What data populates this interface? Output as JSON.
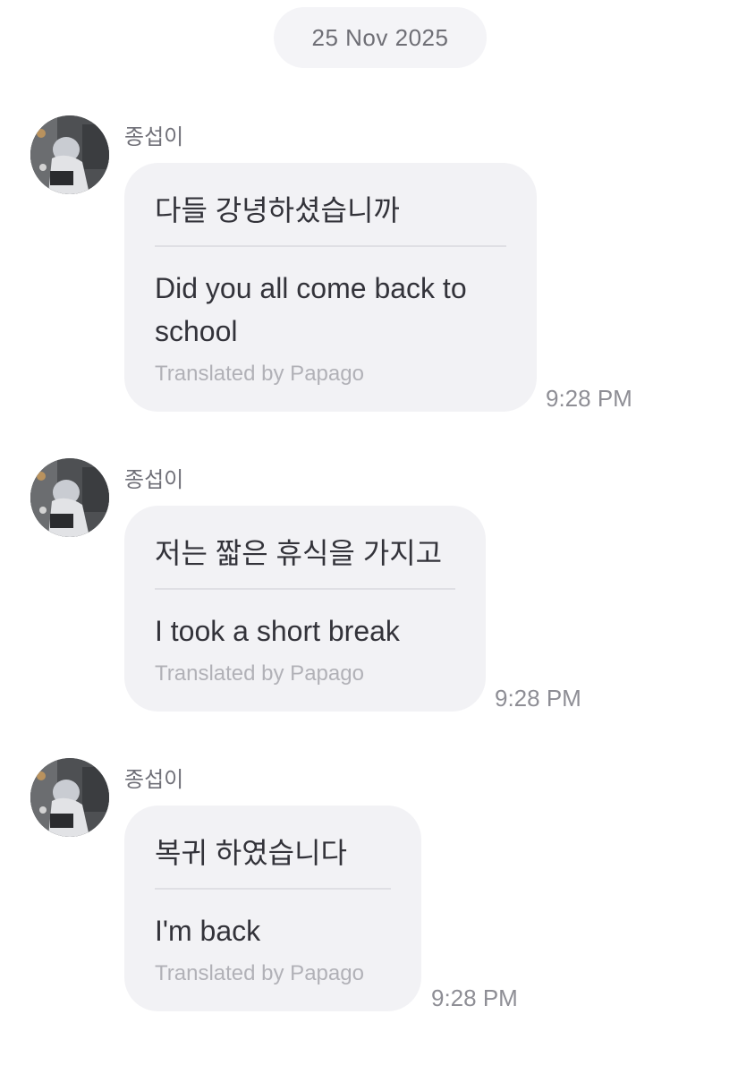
{
  "date_separator": "25 Nov 2025",
  "messages": [
    {
      "sender": "종섭이",
      "avatar_icon": "profile-photo",
      "original": "다들 강녕하셨습니까",
      "translated": "Did you all come back to school",
      "credit": "Translated by Papago",
      "time": "9:28 PM"
    },
    {
      "sender": "종섭이",
      "avatar_icon": "profile-photo",
      "original": "저는 짧은 휴식을 가지고",
      "translated": "I took a short break",
      "credit": "Translated by Papago",
      "time": "9:28 PM"
    },
    {
      "sender": "종섭이",
      "avatar_icon": "profile-photo",
      "original": "복귀 하였습니다",
      "translated": "I'm back",
      "credit": "Translated by Papago",
      "time": "9:28 PM"
    }
  ],
  "colors": {
    "bubble": "#f2f2f5",
    "date_pill": "#f4f4f7",
    "divider": "#dfdfe4",
    "credit_text": "#b1b1b7",
    "time_text": "#8e8e95"
  }
}
